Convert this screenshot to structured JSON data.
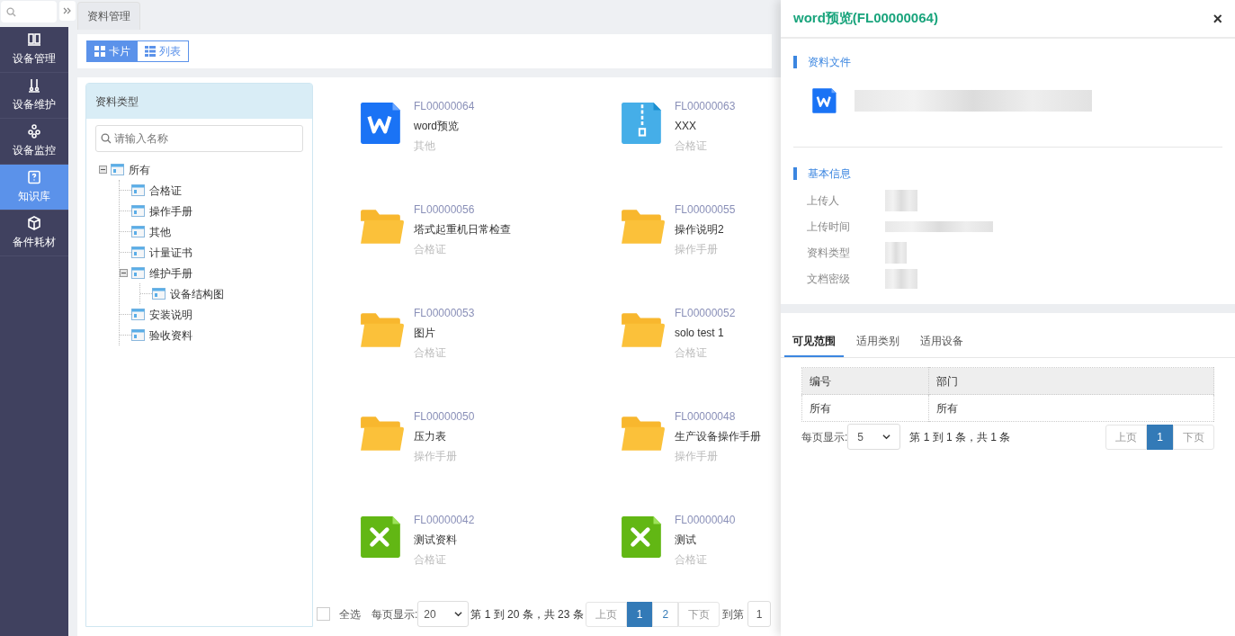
{
  "nav": {
    "items": [
      {
        "label": "设备管理",
        "kind": "book",
        "selected": false
      },
      {
        "label": "设备维护",
        "kind": "tools",
        "selected": false
      },
      {
        "label": "设备监控",
        "kind": "monitor",
        "selected": false
      },
      {
        "label": "知识库",
        "kind": "question",
        "selected": true
      },
      {
        "label": "备件耗材",
        "kind": "box",
        "selected": false
      }
    ]
  },
  "page_tabs": [
    {
      "label": "资料管理",
      "selected": true
    }
  ],
  "view_toggle": [
    {
      "label": "卡片",
      "selected": true
    },
    {
      "label": "列表",
      "selected": false
    }
  ],
  "type_panel": {
    "title": "资料类型",
    "search_placeholder": "请输入名称",
    "tree": [
      {
        "label": "所有",
        "expanded": true,
        "children": [
          {
            "label": "合格证"
          },
          {
            "label": "操作手册"
          },
          {
            "label": "其他"
          },
          {
            "label": "计量证书"
          },
          {
            "label": "维护手册",
            "expanded": true,
            "children": [
              {
                "label": "设备结构图"
              }
            ]
          },
          {
            "label": "安装说明"
          },
          {
            "label": "验收资料"
          }
        ]
      }
    ]
  },
  "cards": [
    {
      "code": "FL00000064",
      "name": "word预览",
      "type": "其他",
      "kind": "word"
    },
    {
      "code": "FL00000063",
      "name": "XXX",
      "type": "合格证",
      "kind": "zip"
    },
    {
      "code": "FL00000056",
      "name": "塔式起重机日常检查",
      "type": "合格证",
      "kind": "folder"
    },
    {
      "code": "FL00000055",
      "name": "操作说明2",
      "type": "操作手册",
      "kind": "folder"
    },
    {
      "code": "FL00000053",
      "name": "图片",
      "type": "合格证",
      "kind": "folder"
    },
    {
      "code": "FL00000052",
      "name": "solo test 1",
      "type": "合格证",
      "kind": "folder"
    },
    {
      "code": "FL00000050",
      "name": "压力表",
      "type": "操作手册",
      "kind": "folder"
    },
    {
      "code": "FL00000048",
      "name": "生产设备操作手册",
      "type": "操作手册",
      "kind": "folder"
    },
    {
      "code": "FL00000042",
      "name": "测试资料",
      "type": "合格证",
      "kind": "excel"
    },
    {
      "code": "FL00000040",
      "name": "测试",
      "type": "合格证",
      "kind": "excel"
    }
  ],
  "pagination": {
    "select_all": {
      "label": "全选",
      "checked": false
    },
    "page_size_label": "每页显示:",
    "page_size": "20",
    "summary": "第 1 到 20 条，共 23 条",
    "pages": [
      {
        "label": "上页",
        "selected": false
      },
      {
        "label": "1",
        "selected": true
      },
      {
        "label": "2",
        "selected": false
      },
      {
        "label": "下页",
        "selected": false
      }
    ],
    "goto_label": "到第",
    "goto_value": "1"
  },
  "drawer": {
    "title": "word预览(FL00000064)",
    "close": "×",
    "file_section": {
      "title": "资料文件",
      "kind": "word"
    },
    "info_section": {
      "title": "基本信息",
      "fields": [
        {
          "label": "上传人"
        },
        {
          "label": "上传时间"
        },
        {
          "label": "资料类型"
        },
        {
          "label": "文档密级"
        }
      ]
    },
    "tabs": [
      {
        "label": "可见范围",
        "selected": true
      },
      {
        "label": "适用类别",
        "selected": false
      },
      {
        "label": "适用设备",
        "selected": false
      }
    ],
    "table": {
      "columns": [
        "编号",
        "部门"
      ],
      "rows": [
        [
          "所有",
          "所有"
        ]
      ]
    },
    "pagination": {
      "page_size_label": "每页显示:",
      "page_size": "5",
      "summary": "第 1 到 1 条，共 1 条",
      "pages": [
        {
          "label": "上页",
          "selected": false
        },
        {
          "label": "1",
          "selected": true
        },
        {
          "label": "下页",
          "selected": false
        }
      ]
    }
  }
}
